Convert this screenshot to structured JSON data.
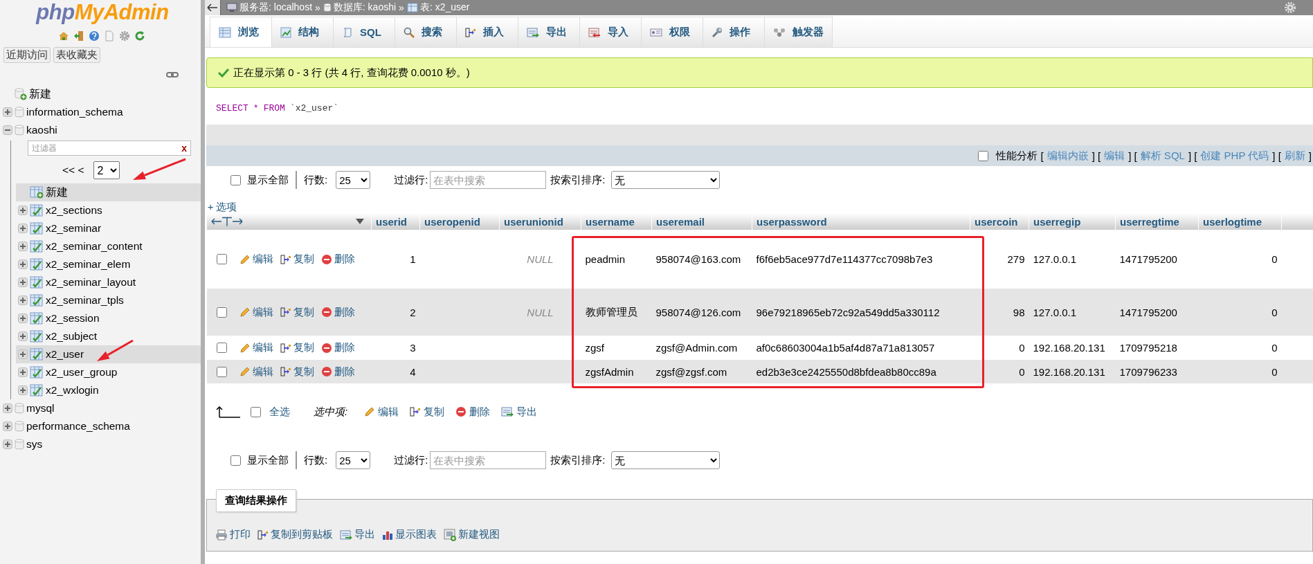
{
  "sidebar": {
    "logo": {
      "part_1": "php",
      "part_2": "MyAdmin"
    },
    "buttons": [
      "近期访问",
      "表收藏夹"
    ],
    "tree": [
      {
        "label": "新建",
        "kind": "new",
        "selected": false
      },
      {
        "label": "information_schema",
        "kind": "database",
        "expanded": false,
        "selected": false
      },
      {
        "label": "kaoshi",
        "kind": "database",
        "expanded": true,
        "selected": false,
        "filter": {
          "placeholder": "过滤器",
          "clear": "x"
        },
        "pager": {
          "prev": "<< <",
          "page": "2"
        },
        "children": [
          {
            "label": "新建",
            "kind": "new_table",
            "selected": true
          },
          {
            "label": "x2_sections",
            "kind": "table",
            "expanded": false,
            "selected": false
          },
          {
            "label": "x2_seminar",
            "kind": "table",
            "expanded": false,
            "selected": false
          },
          {
            "label": "x2_seminar_content",
            "kind": "table",
            "expanded": false,
            "selected": false
          },
          {
            "label": "x2_seminar_elem",
            "kind": "table",
            "expanded": false,
            "selected": false
          },
          {
            "label": "x2_seminar_layout",
            "kind": "table",
            "expanded": false,
            "selected": false
          },
          {
            "label": "x2_seminar_tpls",
            "kind": "table",
            "expanded": false,
            "selected": false
          },
          {
            "label": "x2_session",
            "kind": "table",
            "expanded": false,
            "selected": false
          },
          {
            "label": "x2_subject",
            "kind": "table",
            "expanded": false,
            "selected": false
          },
          {
            "label": "x2_user",
            "kind": "table",
            "expanded": false,
            "selected": true
          },
          {
            "label": "x2_user_group",
            "kind": "table",
            "expanded": false,
            "selected": false
          },
          {
            "label": "x2_wxlogin",
            "kind": "table",
            "expanded": false,
            "selected": false
          }
        ]
      },
      {
        "label": "mysql",
        "kind": "database",
        "expanded": false,
        "selected": false
      },
      {
        "label": "performance_schema",
        "kind": "database",
        "expanded": false,
        "selected": false
      },
      {
        "label": "sys",
        "kind": "database",
        "expanded": false,
        "selected": false
      }
    ]
  },
  "breadcrumb": {
    "separator": "»",
    "items": [
      {
        "label": "服务器: localhost",
        "kind": "server"
      },
      {
        "label": "数据库: kaoshi",
        "kind": "database"
      },
      {
        "label": "表: x2_user",
        "kind": "table"
      }
    ]
  },
  "tabs": [
    {
      "label": "浏览",
      "kind": "browse",
      "selected": true
    },
    {
      "label": "结构",
      "kind": "structure",
      "selected": false
    },
    {
      "label": "SQL",
      "kind": "sql",
      "selected": false
    },
    {
      "label": "搜索",
      "kind": "search",
      "selected": false
    },
    {
      "label": "插入",
      "kind": "insert",
      "selected": false
    },
    {
      "label": "导出",
      "kind": "export",
      "selected": false
    },
    {
      "label": "导入",
      "kind": "import",
      "selected": false
    },
    {
      "label": "权限",
      "kind": "privileges",
      "selected": false
    },
    {
      "label": "操作",
      "kind": "operations",
      "selected": false
    },
    {
      "label": "触发器",
      "kind": "triggers",
      "selected": false
    }
  ],
  "message": "正在显示第 0 - 3 行 (共 4 行, 查询花费 0.0010 秒。)",
  "sql": [
    {
      "text": "SELECT",
      "kind": "keyword"
    },
    {
      "text": "*",
      "kind": "operator"
    },
    {
      "text": "FROM",
      "kind": "keyword"
    },
    {
      "text": "`x2_user`",
      "kind": "identifier"
    }
  ],
  "profiling": {
    "label": "性能分析",
    "checked": false,
    "items": [
      {
        "text": "[",
        "kind": "text"
      },
      {
        "text": "编辑内嵌",
        "kind": "link"
      },
      {
        "text": "] [",
        "kind": "text"
      },
      {
        "text": "编辑",
        "kind": "link"
      },
      {
        "text": "] [",
        "kind": "text"
      },
      {
        "text": "解析 SQL",
        "kind": "link"
      },
      {
        "text": "] [",
        "kind": "text"
      },
      {
        "text": "创建 PHP 代码",
        "kind": "link"
      },
      {
        "text": "] [",
        "kind": "text"
      },
      {
        "text": "刷新",
        "kind": "link"
      },
      {
        "text": "]",
        "kind": "text"
      }
    ]
  },
  "navs": [
    {
      "show_all": "显示全部",
      "show_all_checked": false,
      "rows_label": "行数:",
      "rows": "25",
      "filter_label": "过滤行:",
      "filter_placeholder": "在表中搜索",
      "sort_label": "按索引排序:",
      "sort": "无"
    },
    {
      "show_all": "显示全部",
      "show_all_checked": false,
      "rows_label": "行数:",
      "rows": "25",
      "filter_label": "过滤行:",
      "filter_placeholder": "在表中搜索",
      "sort_label": "按索引排序:",
      "sort": "无"
    }
  ],
  "options_link": "+ 选项",
  "table": {
    "columns": [
      "userid",
      "useropenid",
      "userunionid",
      "username",
      "useremail",
      "userpassword",
      "usercoin",
      "userregip",
      "userregtime",
      "userlogtime"
    ],
    "rows": [
      {
        "checked": false,
        "actions": [
          {
            "label": "编辑",
            "kind": "edit"
          },
          {
            "label": "复制",
            "kind": "copy"
          },
          {
            "label": "删除",
            "kind": "delete"
          }
        ],
        "cells": [
          {
            "text": "1",
            "kind": "number"
          },
          {
            "kind": "empty"
          },
          {
            "text": "NULL",
            "kind": "null"
          },
          {
            "text": "peadmin",
            "kind": "text"
          },
          {
            "text": "958074@163.com",
            "kind": "text"
          },
          {
            "text": "f6f6eb5ace977d7e114377cc7098b7e3",
            "kind": "text"
          },
          {
            "text": "279",
            "kind": "number"
          },
          {
            "text": "127.0.0.1",
            "kind": "text"
          },
          {
            "text": "1471795200",
            "kind": "text"
          },
          {
            "text": "0",
            "kind": "number"
          }
        ]
      },
      {
        "checked": false,
        "actions": [
          {
            "label": "编辑",
            "kind": "edit"
          },
          {
            "label": "复制",
            "kind": "copy"
          },
          {
            "label": "删除",
            "kind": "delete"
          }
        ],
        "cells": [
          {
            "text": "2",
            "kind": "number"
          },
          {
            "kind": "empty"
          },
          {
            "text": "NULL",
            "kind": "null"
          },
          {
            "text": "教师管理员",
            "kind": "text"
          },
          {
            "text": "958074@126.com",
            "kind": "text"
          },
          {
            "text": "96e79218965eb72c92a549dd5a330112",
            "kind": "text"
          },
          {
            "text": "98",
            "kind": "number"
          },
          {
            "text": "127.0.0.1",
            "kind": "text"
          },
          {
            "text": "1471795200",
            "kind": "text"
          },
          {
            "text": "0",
            "kind": "number"
          }
        ]
      },
      {
        "checked": false,
        "actions": [
          {
            "label": "编辑",
            "kind": "edit"
          },
          {
            "label": "复制",
            "kind": "copy"
          },
          {
            "label": "删除",
            "kind": "delete"
          }
        ],
        "cells": [
          {
            "text": "3",
            "kind": "number"
          },
          {
            "kind": "empty"
          },
          {
            "kind": "empty"
          },
          {
            "text": "zgsf",
            "kind": "text"
          },
          {
            "text": "zgsf@Admin.com",
            "kind": "text"
          },
          {
            "text": "af0c68603004a1b5af4d87a71a813057",
            "kind": "text"
          },
          {
            "text": "0",
            "kind": "number"
          },
          {
            "text": "192.168.20.131",
            "kind": "text"
          },
          {
            "text": "1709795218",
            "kind": "text"
          },
          {
            "text": "0",
            "kind": "number"
          }
        ]
      },
      {
        "checked": false,
        "actions": [
          {
            "label": "编辑",
            "kind": "edit"
          },
          {
            "label": "复制",
            "kind": "copy"
          },
          {
            "label": "删除",
            "kind": "delete"
          }
        ],
        "cells": [
          {
            "text": "4",
            "kind": "number"
          },
          {
            "kind": "empty"
          },
          {
            "kind": "empty"
          },
          {
            "text": "zgsfAdmin",
            "kind": "text"
          },
          {
            "text": "zgsf@zgsf.com",
            "kind": "text"
          },
          {
            "text": "ed2b3e3ce2425550d8bfdea8b80cc89a",
            "kind": "text"
          },
          {
            "text": "0",
            "kind": "number"
          },
          {
            "text": "192.168.20.131",
            "kind": "text"
          },
          {
            "text": "1709796233",
            "kind": "text"
          },
          {
            "text": "0",
            "kind": "number"
          }
        ]
      }
    ]
  },
  "bulk": {
    "check_all": "全选",
    "checked": false,
    "with_selected": "选中项:",
    "actions": [
      {
        "label": "编辑",
        "kind": "edit"
      },
      {
        "label": "复制",
        "kind": "copy"
      },
      {
        "label": "删除",
        "kind": "delete"
      },
      {
        "label": "导出",
        "kind": "export"
      }
    ]
  },
  "result_ops": {
    "legend": "查询结果操作",
    "actions": [
      {
        "label": "打印",
        "kind": "print"
      },
      {
        "label": "复制到剪贴板",
        "kind": "copy"
      },
      {
        "label": "导出",
        "kind": "export"
      },
      {
        "label": "显示图表",
        "kind": "chart"
      },
      {
        "label": "新建视图",
        "kind": "view"
      }
    ]
  }
}
